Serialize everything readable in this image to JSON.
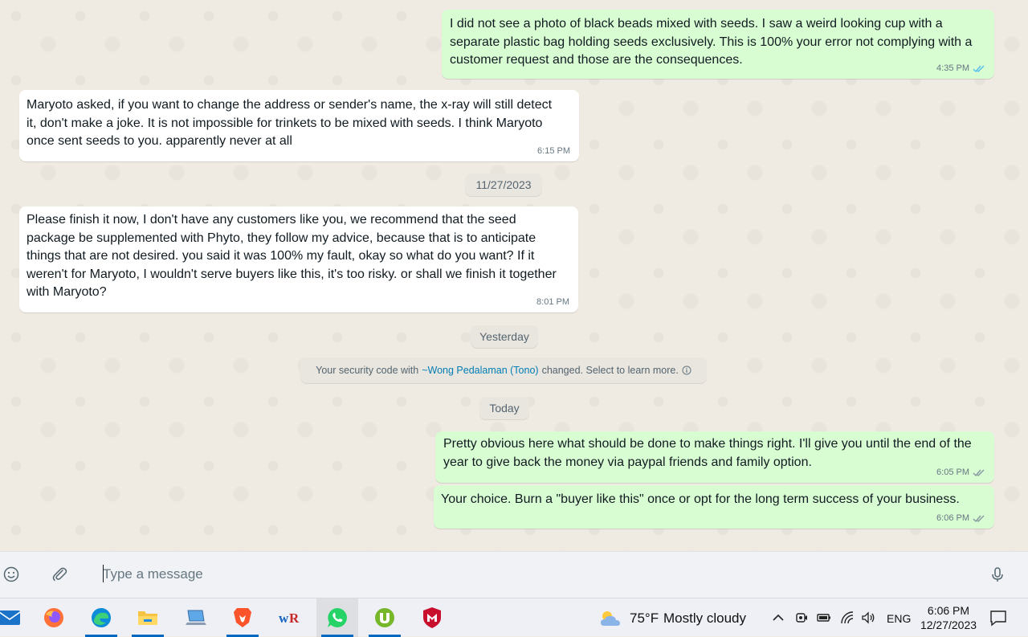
{
  "messages": [
    {
      "dir": "out",
      "text": "I did not see a photo of black beads mixed with seeds. I saw a weird looking cup with a separate plastic bag holding seeds exclusively. This is 100% your error not complying with a customer request and those are the consequences.",
      "time": "4:35 PM"
    },
    {
      "dir": "in",
      "text": "Maryoto asked, if you want to change the address or sender's name, the x-ray will still detect it, don't make a joke.  It is not impossible for trinkets to be mixed with seeds.  I think Maryoto once sent seeds to you.  apparently never at all",
      "time": "6:15 PM"
    },
    {
      "dir": "in",
      "text": "Please finish it now, I don't have any customers like you, we recommend that the seed package be supplemented with Phyto, they follow my advice, because that is to anticipate things that are not desired.  you said it was 100% my fault, okay so what do you want?  If it weren't for Maryoto, I wouldn't serve buyers like this, it's too risky.  or shall we finish it together with Maryoto?",
      "time": "8:01 PM"
    },
    {
      "dir": "out",
      "text": "Pretty obvious here what should be done to make things right. I'll give you until the end of the year to give back the money via paypal friends and family option.",
      "time": "6:05 PM"
    },
    {
      "dir": "out",
      "text": "Your choice. Burn a \"buyer like this\" once or opt for the long term success of your business.",
      "time": "6:06 PM"
    }
  ],
  "dates": [
    "11/27/2023",
    "Yesterday",
    "Today"
  ],
  "system_notice": {
    "prefix": "Your security code with ",
    "contact": "~Wong Pedalaman (Tono)",
    "suffix": " changed. Select to learn more."
  },
  "composer": {
    "placeholder": "Type a message"
  },
  "taskbar": {
    "apps": [
      "mail",
      "firefox",
      "edge",
      "file-explorer",
      "this-pc",
      "brave",
      "winrar",
      "whatsapp",
      "utorrent",
      "mcafee"
    ],
    "weather": {
      "temp": "75°F",
      "condition": "Mostly cloudy"
    },
    "language": "ENG",
    "time": "6:06 PM",
    "date": "12/27/2023"
  },
  "colors": {
    "outgoing": "#d9fdd3",
    "incoming": "#ffffff",
    "ticks": "#53bdeb",
    "link": "#027eb5"
  }
}
